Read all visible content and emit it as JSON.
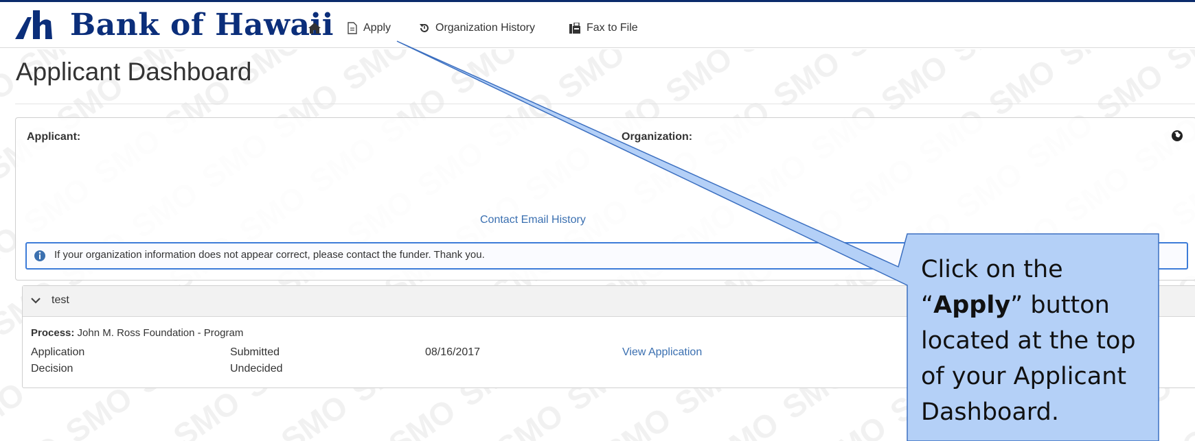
{
  "header": {
    "brand": "Bank of Hawaii",
    "nav": [
      {
        "icon": "home-icon",
        "label": ""
      },
      {
        "icon": "document-icon",
        "label": "Apply"
      },
      {
        "icon": "history-icon",
        "label": "Organization History"
      },
      {
        "icon": "fax-icon",
        "label": "Fax to File"
      }
    ]
  },
  "page": {
    "title": "Applicant Dashboard"
  },
  "applicant_panel": {
    "applicant_label": "Applicant:",
    "organization_label": "Organization:",
    "contact_link": "Contact Email History",
    "info_text": "If your organization information does not appear correct, please contact the funder. Thank you."
  },
  "test_panel": {
    "title": "test",
    "process_label": "Process:",
    "process_value": "John M. Ross Foundation - Program",
    "rows": [
      {
        "name": "Application",
        "status": "Submitted",
        "date": "08/16/2017",
        "action": "View Application"
      },
      {
        "name": "Decision",
        "status": "Undecided",
        "date": "",
        "action": ""
      }
    ]
  },
  "callout": {
    "line1": "Click on the",
    "open_quote": "“",
    "bold": "Apply",
    "close_quote": "” button",
    "line3": "located at the top",
    "line4": "of your Applicant",
    "line5": "Dashboard."
  },
  "colors": {
    "brand": "#0b2e7a",
    "link": "#3a6fb0",
    "info_border": "#3c7bd8",
    "callout_fill": "#b4d0f7"
  }
}
